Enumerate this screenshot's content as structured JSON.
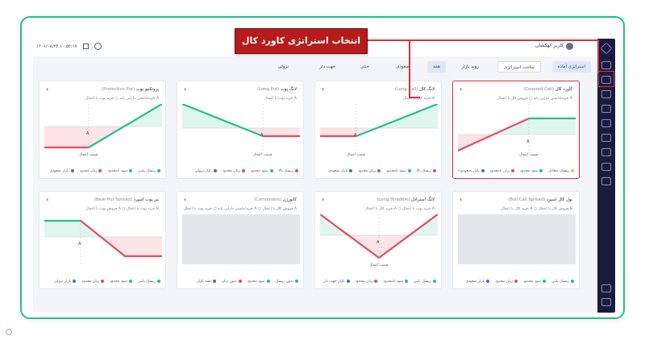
{
  "callout": "انتخاب استراتژی کاورد کال",
  "topbar": {
    "user": "کاربر کهکشان",
    "date": "۱۴۰۱/۰۸/۲۴ ۱۰:۵۲:۱۷"
  },
  "filters": [
    {
      "label": "استراتژی آماده",
      "active": true
    },
    {
      "label": "ساخت استراتژی",
      "active": false
    },
    {
      "label": "روند بازار",
      "active": false
    },
    {
      "label": "همه",
      "active": true
    },
    {
      "label": "صعودی",
      "active": false
    },
    {
      "label": "خنثی",
      "active": false
    },
    {
      "label": "جهت دار",
      "active": false
    },
    {
      "label": "نزولی",
      "active": false
    }
  ],
  "cards": [
    {
      "title": "کاورد کال",
      "en": "(Covered Call)",
      "sub": "خرید/داشتن دارایی پایه  ○ فروش کال با اعمال A",
      "legend": [
        [
          "ریسک متعادل",
          "#f2c14e"
        ],
        [
          "سود محدود",
          "#22c08a"
        ],
        [
          "زیان نامحدود",
          "#e84a5f"
        ],
        [
          "بازار صعودی/خنثی",
          "#3b6fd8"
        ]
      ],
      "axis": "قیمت اعمال",
      "mark": "A"
    },
    {
      "title": "لانگ کال",
      "en": "(Long Call)",
      "sub": "خرید کال با اعمال A",
      "legend": [
        [
          "ریسک بالا",
          "#e84a5f"
        ],
        [
          "سود نامحدود",
          "#22c08a"
        ],
        [
          "زیان محدود",
          "#e84a5f"
        ],
        [
          "بازار صعودی",
          "#3b6fd8"
        ]
      ],
      "axis": "قیمت اعمال",
      "mark": "A"
    },
    {
      "title": "لانگ پوت",
      "en": "(Long Put)",
      "sub": "خرید پوت با اعمال A",
      "legend": [
        [
          "ریسک بالا",
          "#e84a5f"
        ],
        [
          "سود محدود",
          "#22c08a"
        ],
        [
          "زیان محدود",
          "#e84a5f"
        ],
        [
          "بازار نزولی",
          "#3b6fd8"
        ]
      ],
      "axis": "قیمت اعمال",
      "mark": "A"
    },
    {
      "title": "پروتکتیو پوت",
      "en": "(Protective Put)",
      "sub": "خرید/داشتن دارایی پایه  ○ خرید پوت با اعمال A",
      "legend": [
        [
          "ریسک پایین",
          "#22c08a"
        ],
        [
          "سود نامحدود",
          "#22c08a"
        ],
        [
          "زیان محدود",
          "#e84a5f"
        ],
        [
          "بازار صعودی",
          "#3b6fd8"
        ]
      ],
      "axis": "قیمت اعمال",
      "mark": "A"
    },
    {
      "title": "بول کال اسپرد",
      "en": "(Bull Call Spread)",
      "sub": "خرید کال با اعمال A  ○ فروش کال با اعمال B",
      "legend": [
        [
          "ریسک پایین",
          "#22c08a"
        ],
        [
          "سود محدود",
          "#22c08a"
        ],
        [
          "زیان محدود",
          "#e84a5f"
        ],
        [
          "بازار صعودی",
          "#3b6fd8"
        ]
      ],
      "axis": "",
      "mark": ""
    },
    {
      "title": "لانگ استرادل",
      "en": "(Long Straddle)",
      "sub": "خرید کال با اعمال A  ○ خرید پوت با اعمال A",
      "legend": [
        [
          "ریسک پایین",
          "#22c08a"
        ],
        [
          "سود نامحدود",
          "#22c08a"
        ],
        [
          "زیان محدود",
          "#e84a5f"
        ],
        [
          "بازار جهت دار",
          "#3b6fd8"
        ]
      ],
      "axis": "قیمت اعمال",
      "mark": "A"
    },
    {
      "title": "کانورژن",
      "en": "(Conversion)",
      "sub": "خرید/داشتن دارایی پایه  ○ خرید پوت با اعمال A  ○ فروش کال با اعمال A",
      "legend": [
        [
          "بدون ریسک",
          "#22c08a"
        ],
        [
          "سود محدود",
          "#22c08a"
        ],
        [
          "بدون زیان",
          "#e84a5f"
        ],
        [
          "همه بازار",
          "#3b6fd8"
        ]
      ],
      "axis": "",
      "mark": ""
    },
    {
      "title": "بیر پوت اسپرد",
      "en": "(Bear Put Spread)",
      "sub": "فروش پوت با اعمال A  ○ خرید پوت با اعمال B",
      "legend": [
        [
          "ریسک پایین",
          "#22c08a"
        ],
        [
          "سود محدود",
          "#22c08a"
        ],
        [
          "زیان محدود",
          "#e84a5f"
        ],
        [
          "بازار نزولی",
          "#3b6fd8"
        ]
      ],
      "axis": "",
      "mark": "A B"
    }
  ],
  "colors": {
    "profit": "#22c08a",
    "loss": "#e84a5f",
    "accent": "#b71c1c",
    "sidebar": "#1b1b3d"
  }
}
